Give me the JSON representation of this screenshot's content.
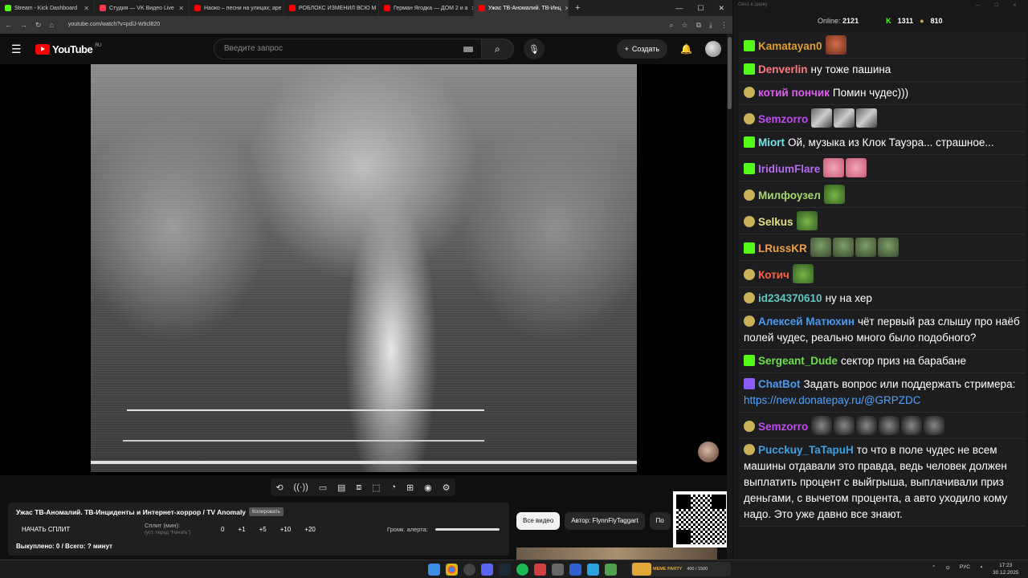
{
  "browser": {
    "tabs": [
      {
        "label": "Stream - Kick Dashboard",
        "color": "#53fc18"
      },
      {
        "label": "Студия — VK Видео Live",
        "color": "#ff3347"
      },
      {
        "label": "Наоко – песни на улицах; аре",
        "color": "#ff0000"
      },
      {
        "label": "РОБЛОКС ИЗМЕНИЛ ВСЮ М",
        "color": "#ff0000"
      },
      {
        "label": "Герман Ягодка — ДОМ 2 и а",
        "color": "#ff0000"
      },
      {
        "label": "Ужас ТВ-Аномалий. ТВ-Инц",
        "color": "#ff0000"
      }
    ],
    "new_tab": "+",
    "url": "youtube.com/watch?v=pdlJ-W9cl820"
  },
  "youtube": {
    "logo_text": "YouTube",
    "region": "RU",
    "search_placeholder": "Введите запрос",
    "create_label": "Создать"
  },
  "panel": {
    "title": "Ужас ТВ-Аномалий. ТВ-Инциденты и Интернет-хоррор / TV Anomaly",
    "copy_label": "Копировать",
    "start_split": "НАЧАТЬ СПЛИТ",
    "split_label": "Сплит (мин):",
    "split_hint": "(уст. перед \"Начать\")",
    "split_values": [
      "0",
      "+1",
      "+5",
      "+10",
      "+20"
    ],
    "volume_label": "Громк. алерта:",
    "bought": "Выкуплено: 0 / Всего: ? минут"
  },
  "chips": [
    "Все видео",
    "Автор: FlynnFlyTaggart",
    "По"
  ],
  "chat": {
    "window_title": "Окно в дирку",
    "online_label": "Online:",
    "online_count": "2121",
    "kick_count": "1311",
    "other_count": "810",
    "messages": [
      {
        "user": "Kamatayan0",
        "color": "#e0a030",
        "badge": "k",
        "text": "",
        "emotes": [
          "e-face"
        ]
      },
      {
        "user": "Denverlin",
        "color": "#ff7a7a",
        "badge": "k",
        "text": "ну тоже пашина",
        "emotes": []
      },
      {
        "user": "котий пончик",
        "color": "#e15cf0",
        "badge": "p",
        "text": "Помин чудес)))",
        "emotes": []
      },
      {
        "user": "Semzorro",
        "color": "#c04cf0",
        "badge": "p",
        "text": "",
        "emotes": [
          "e-gray",
          "e-gray",
          "e-gray"
        ]
      },
      {
        "user": "Miort",
        "color": "#6ee6e6",
        "badge": "k",
        "text": "Ой, музыка из Клок Тауэра... страшное...",
        "emotes": []
      },
      {
        "user": "IridiumFlare",
        "color": "#b46cf0",
        "badge": "k",
        "text": "",
        "emotes": [
          "e-pink",
          "e-pink"
        ]
      },
      {
        "user": "Милфоузел",
        "color": "#a8d86a",
        "badge": "p",
        "text": "",
        "emotes": [
          "e-frog"
        ]
      },
      {
        "user": "Selkus",
        "color": "#e6e080",
        "badge": "p",
        "text": "",
        "emotes": [
          "e-frog"
        ]
      },
      {
        "user": "LRussKR",
        "color": "#f0a040",
        "badge": "k",
        "text": "",
        "emotes": [
          "e-guy",
          "e-guy",
          "e-guy",
          "e-guy"
        ]
      },
      {
        "user": "Котич",
        "color": "#ff6040",
        "badge": "p",
        "text": "",
        "emotes": [
          "e-frog"
        ]
      },
      {
        "user": "id234370610",
        "color": "#60c8c0",
        "badge": "p",
        "text": "ну на хер",
        "emotes": []
      },
      {
        "user": "Алексей Матюхин",
        "color": "#4a9cf0",
        "badge": "p",
        "text": "чёт первый раз слышу про наёб полей чудес, реально много было подобного?",
        "emotes": []
      },
      {
        "user": "Sergeant_Dude",
        "color": "#6ce04a",
        "badge": "k",
        "text": "сектор приз на барабане",
        "emotes": []
      },
      {
        "user": "ChatBot",
        "color": "#4a9cf0",
        "badge": "bot",
        "text": "Задать вопрос или поддержать стримера:",
        "link": "https://new.donatepay.ru/@GRPZDC",
        "emotes": []
      },
      {
        "user": "Semzorro",
        "color": "#c04cf0",
        "badge": "p",
        "text": "",
        "emotes": [
          "e-dark",
          "e-dark",
          "e-dark",
          "e-dark",
          "e-dark",
          "e-dark"
        ]
      },
      {
        "user": "Pucckuy_TaTapuH",
        "color": "#40a0e0",
        "badge": "p",
        "text": "то что в поле чудес не всем машины отдавали это правда, ведь человек должен выплатить процент с выйгрыша, выплачивали приз деньгами, с вычетом процента, а авто уходило кому надо. Это уже давно все знают.",
        "emotes": []
      }
    ]
  },
  "taskbar": {
    "widget_title": "MEME PARTY",
    "widget_value": "400 / 1500",
    "lang": "РУС",
    "time": "17:23",
    "date": "30.12.2025"
  }
}
